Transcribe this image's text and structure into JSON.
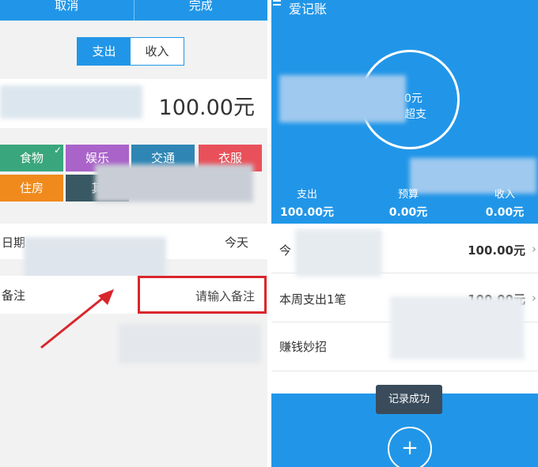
{
  "left": {
    "topbar": {
      "cancel": "取消",
      "done": "完成"
    },
    "toggle": {
      "expense": "支出",
      "income": "收入"
    },
    "amount": "100.00元",
    "categories": [
      {
        "label": "食物",
        "color": "#3aa67d",
        "selected": true
      },
      {
        "label": "娱乐",
        "color": "#a963c9"
      },
      {
        "label": "交通",
        "color": "#2f86b4"
      },
      {
        "label": "衣服",
        "color": "#e9515a"
      },
      {
        "label": "住房",
        "color": "#f08a1c"
      },
      {
        "label": "其",
        "color": "#385863"
      }
    ],
    "date_label": "日期",
    "date_value": "今天",
    "note_label": "备注",
    "note_placeholder": "请输入备注"
  },
  "right": {
    "title": "爱记账",
    "ring_amount": "0元",
    "ring_sub": "超支",
    "stats": [
      {
        "label": "支出",
        "value": "100.00元"
      },
      {
        "label": "预算",
        "value": "0.00元"
      },
      {
        "label": "收入",
        "value": "0.00元"
      }
    ],
    "rows": [
      {
        "label": "今",
        "value": "100.00元"
      },
      {
        "label": "本周支出1笔",
        "value": "100.00元"
      },
      {
        "label": "赚钱妙招",
        "value": ""
      }
    ],
    "toast": "记录成功",
    "fab": "+"
  }
}
